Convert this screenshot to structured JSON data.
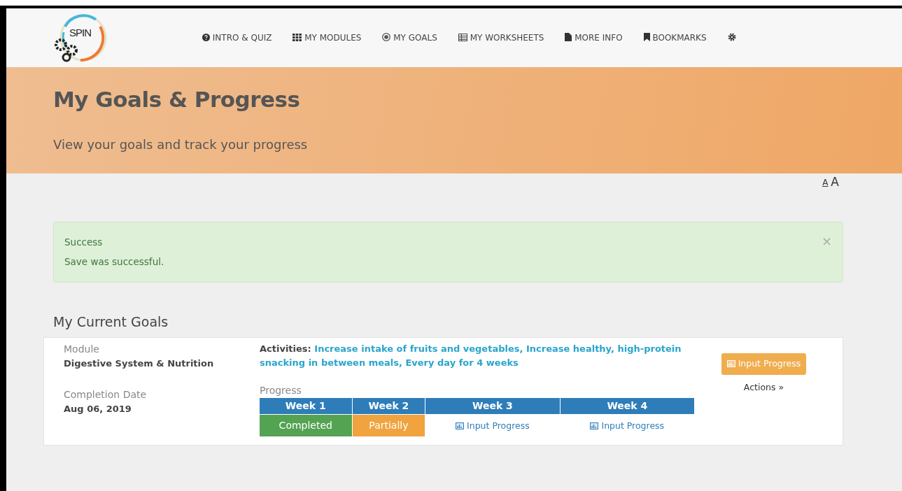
{
  "logo": {
    "text": "SPIN"
  },
  "nav": [
    {
      "label": "INTRO & QUIZ",
      "kind": "question"
    },
    {
      "label": "MY MODULES",
      "kind": "grid"
    },
    {
      "label": "MY GOALS",
      "kind": "target"
    },
    {
      "label": "MY WORKSHEETS",
      "kind": "table"
    },
    {
      "label": "MORE INFO",
      "kind": "file"
    },
    {
      "label": "BOOKMARKS",
      "kind": "bookmark"
    },
    {
      "kind": "gear"
    }
  ],
  "banner": {
    "title": "My Goals & Progress",
    "subtitle": "View your goals and track your progress"
  },
  "font_size_buttons": [
    {
      "label": "A",
      "kind": "small"
    },
    {
      "label": "A",
      "kind": "large"
    }
  ],
  "alert": {
    "title": "Success",
    "message": "Save was successful.",
    "close": "×"
  },
  "section_title": "My Current Goals",
  "goal": {
    "module_label": "Module",
    "module": "Digestive System & Nutrition",
    "date_label": "Completion Date",
    "date": "Aug 06, 2019",
    "activities_label": "Activities:",
    "activities": "Increase intake of fruits and vegetables, Increase healthy, high-protein snacking in between meals, Every day for 4 weeks",
    "progress_label": "Progress",
    "weeks": [
      {
        "label": "Week 1",
        "kind": "completed",
        "text": "Completed"
      },
      {
        "label": "Week 2",
        "kind": "partially",
        "text": "Partially"
      },
      {
        "label": "Week 3",
        "kind": "input",
        "text": "Input Progress"
      },
      {
        "label": "Week 4",
        "kind": "input",
        "text": "Input Progress"
      }
    ],
    "button": "Input Progress",
    "actions": "Actions »"
  }
}
